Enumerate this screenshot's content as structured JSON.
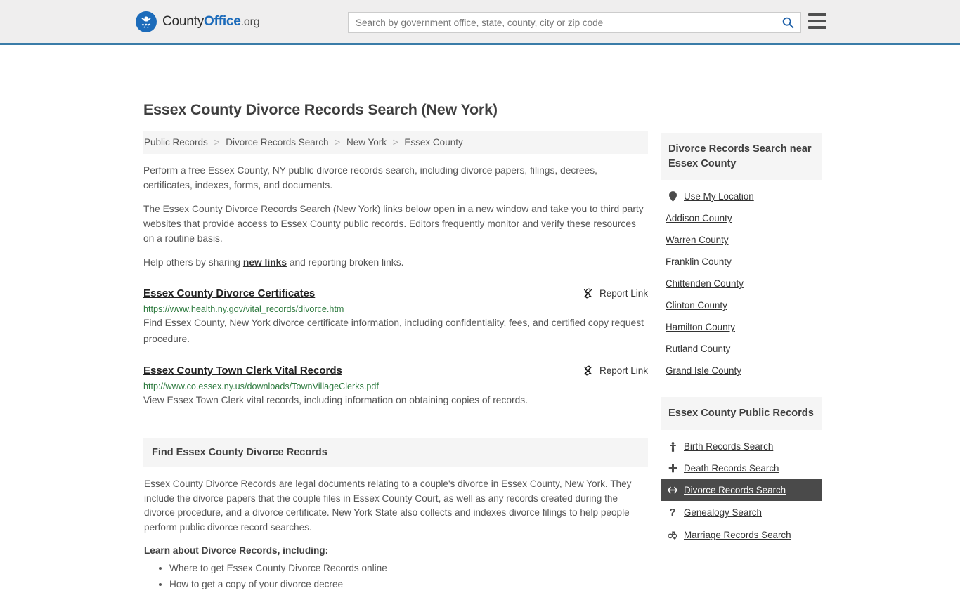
{
  "header": {
    "brand": {
      "part1": "County",
      "part2": "Office",
      "part3": ".org",
      "logo_icon": "eagle-seal-logo"
    },
    "search": {
      "placeholder": "Search by government office, state, county, city or zip code",
      "value": "",
      "button_icon": "search-icon"
    },
    "menu_icon": "hamburger-menu-icon",
    "accent_color": "#3a7ca8",
    "background_color": "#efeeee"
  },
  "page_title": "Essex County Divorce Records Search (New York)",
  "breadcrumb": {
    "items": [
      "Public Records",
      "Divorce Records Search",
      "New York",
      "Essex County"
    ],
    "separator": ">"
  },
  "intro": {
    "p1": "Perform a free Essex County, NY public divorce records search, including divorce papers, filings, decrees, certificates, indexes, forms, and documents.",
    "p2": "The Essex County Divorce Records Search (New York) links below open in a new window and take you to third party websites that provide access to Essex County public records. Editors frequently monitor and verify these resources on a routine basis.",
    "p3_before": "Help others by sharing ",
    "p3_link": "new links",
    "p3_after": " and reporting broken links."
  },
  "results": {
    "report_label": "Report Link",
    "report_icon": "broken-link-icon",
    "items": [
      {
        "title": "Essex County Divorce Certificates",
        "url": "https://www.health.ny.gov/vital_records/divorce.htm",
        "description": "Find Essex County, New York divorce certificate information, including confidentiality, fees, and certified copy request procedure."
      },
      {
        "title": "Essex County Town Clerk Vital Records",
        "url": "http://www.co.essex.ny.us/downloads/TownVillageClerks.pdf",
        "description": "View Essex Town Clerk vital records, including information on obtaining copies of records."
      }
    ]
  },
  "find_section": {
    "heading": "Find Essex County Divorce Records",
    "body": "Essex County Divorce Records are legal documents relating to a couple's divorce in Essex County, New York. They include the divorce papers that the couple files in Essex County Court, as well as any records created during the divorce procedure, and a divorce certificate. New York State also collects and indexes divorce filings to help people perform public divorce record searches.",
    "learn_heading": "Learn about Divorce Records, including:",
    "learn_items": [
      "Where to get Essex County Divorce Records online",
      "How to get a copy of your divorce decree"
    ]
  },
  "sidebar": {
    "nearby": {
      "heading": "Divorce Records Search near Essex County",
      "use_my_location": {
        "label": "Use My Location",
        "icon": "map-pin-icon"
      },
      "counties": [
        "Addison County",
        "Warren County",
        "Franklin County",
        "Chittenden County",
        "Clinton County",
        "Hamilton County",
        "Rutland County",
        "Grand Isle County"
      ]
    },
    "public_records": {
      "heading": "Essex County Public Records",
      "active_color": "#4a4a4a",
      "items": [
        {
          "label": "Birth Records Search",
          "icon": "baby-icon",
          "active": false
        },
        {
          "label": "Death Records Search",
          "icon": "cross-icon",
          "active": false
        },
        {
          "label": "Divorce Records Search",
          "icon": "left-right-arrow-icon",
          "active": true
        },
        {
          "label": "Genealogy Search",
          "icon": "question-mark-icon",
          "active": false
        },
        {
          "label": "Marriage Records Search",
          "icon": "male-female-icon",
          "active": false
        }
      ]
    }
  }
}
